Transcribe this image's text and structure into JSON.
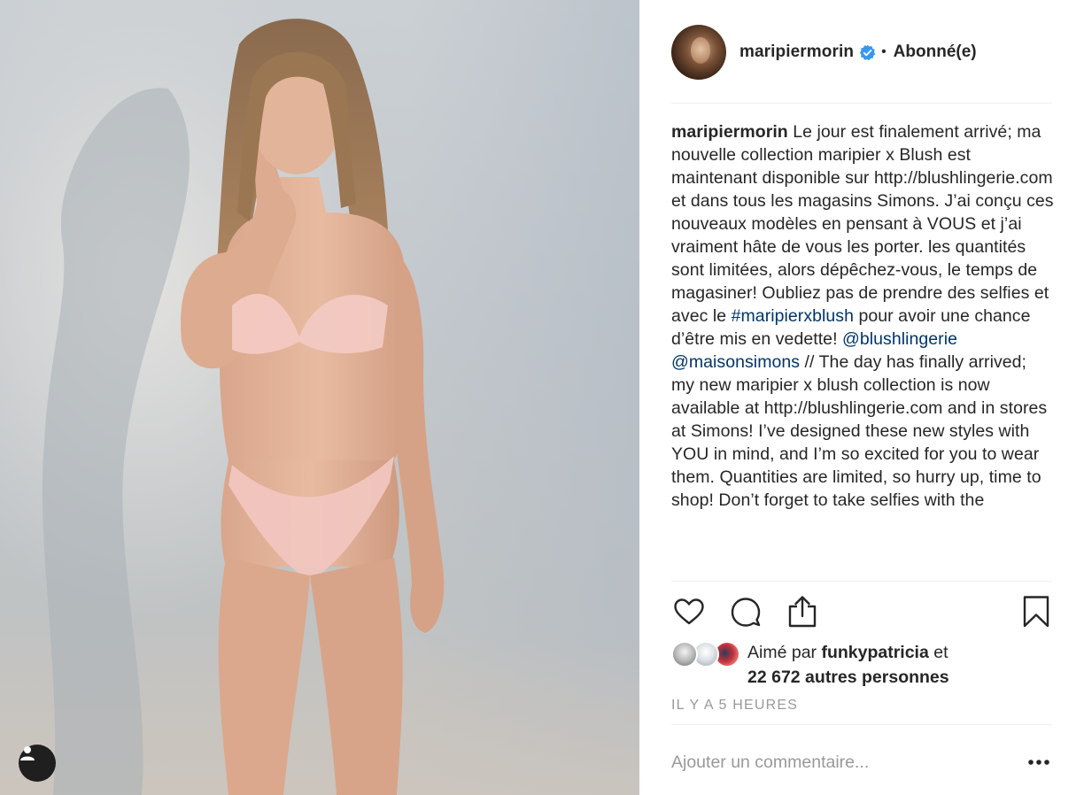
{
  "post": {
    "username": "maripiermorin",
    "follow_status": "Abonné(e)",
    "separator": "•",
    "caption": {
      "username": "maripiermorin",
      "text_1": " Le jour est finalement arrivé; ma nouvelle collection maripier x Blush est maintenant disponible sur http://blushlingerie.com et dans tous les magasins Simons. J’ai conçu ces nouveaux modèles en pensant à VOUS et j’ai vraiment hâte de vous les porter. les quantités sont limitées, alors dépêchez-vous, le temps de magasiner! Oubliez pas de prendre des selfies et avec le ",
      "hashtag": "#maripierxblush",
      "text_2": " pour avoir une chance d’être mis en vedette! ",
      "mention_1": "@blushlingerie",
      "text_3": " ",
      "mention_2": "@maisonsimons",
      "text_4": " // The day has finally arrived; my new maripier x blush collection is now available at http://blushlingerie.com and in stores at Simons! I’ve designed these new styles with YOU in mind, and I’m so excited for you to wear them. Quantities are limited, so hurry up, time to shop! Don’t forget to take selfies with the"
    },
    "likes": {
      "prefix": "Aimé par ",
      "liker": "funkypatricia",
      "connector": " et",
      "others": "22 672 autres personnes"
    },
    "timestamp": "IL Y A 5 HEURES",
    "comment": {
      "placeholder": "Ajouter un commentaire...",
      "value": ""
    },
    "icons": {
      "like": "heart-icon",
      "comment": "comment-bubble-icon",
      "share": "share-icon",
      "save": "bookmark-icon",
      "more": "more-dots-icon",
      "tag": "user-tag-icon",
      "verified": "verified-badge-icon"
    }
  },
  "colors": {
    "text": "#262626",
    "link": "#003569",
    "muted": "#999999",
    "verified": "#3897f0",
    "divider": "#efefef"
  }
}
